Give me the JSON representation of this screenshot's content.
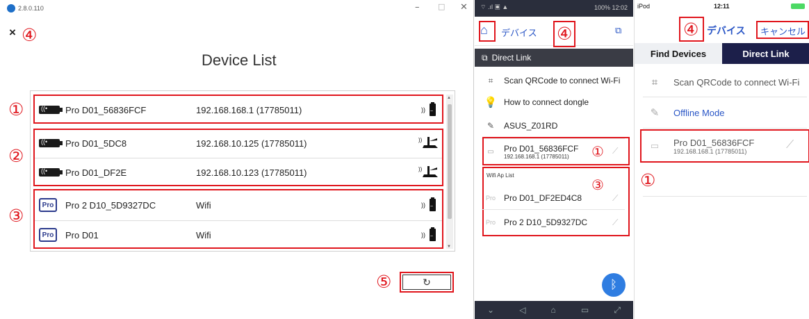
{
  "annotations": {
    "n1": "①",
    "n2": "②",
    "n3": "③",
    "n4": "④",
    "n5": "⑤"
  },
  "desktop": {
    "version": "2.8.0.110",
    "minimize": "–",
    "maximize": "□",
    "close": "✕",
    "close_icon": "×",
    "title": "Device List",
    "devices": [
      {
        "icon": "dongle-icon",
        "name": "Pro D01_56836FCF",
        "ip": "192.168.168.1 (17785011)",
        "signal": "dongle-wifi-icon"
      },
      {
        "icon": "dongle-icon",
        "name": "Pro D01_5DC8",
        "ip": "192.168.10.125 (17785011)",
        "signal": "router-icon"
      },
      {
        "icon": "dongle-icon",
        "name": "Pro D01_DF2E",
        "ip": "192.168.10.123 (17785011)",
        "signal": "router-icon"
      },
      {
        "icon": "pro-icon",
        "name": "Pro 2 D10_5D9327DC",
        "ip": "Wifi",
        "signal": "dongle-wifi-icon"
      },
      {
        "icon": "pro-icon",
        "name": "Pro D01",
        "ip": "Wifi",
        "signal": "dongle-wifi-icon"
      }
    ],
    "pro_label": "Pro",
    "refresh_icon": "↻"
  },
  "android": {
    "status_right": "100% 12:02",
    "header_title": "デバイス",
    "direct_link": "Direct Link",
    "items": [
      {
        "icon": "qr-icon",
        "label": "Scan QRCode to connect Wi-Fi"
      },
      {
        "icon": "bulb-icon",
        "label": "How to connect dongle"
      },
      {
        "icon": "wifi-logo-icon",
        "label": "ASUS_Z01RD"
      }
    ],
    "device": {
      "name": "Pro D01_56836FCF",
      "ip": "192.168.168.1 (17785011)"
    },
    "wifi_ap_title": "Wifi Ap List",
    "wifi_ap": [
      {
        "name": "Pro D01_DF2ED4C8"
      },
      {
        "name": "Pro 2 D10_5D9327DC"
      }
    ],
    "nav": [
      "⌄",
      "◁",
      "⌂",
      "▭",
      "⤢"
    ],
    "bt_icon": "ᛒ"
  },
  "ios": {
    "carrier": "iPod",
    "time": "12:11",
    "header_title": "デバイス",
    "cancel": "キャンセル",
    "tab_find": "Find Devices",
    "tab_direct": "Direct Link",
    "scan": "Scan QRCode to connect Wi-Fi",
    "offline": "Offline Mode",
    "device": {
      "name": "Pro D01_56836FCF",
      "ip": "192.168.168.1 (17785011)"
    }
  },
  "colors": {
    "annotation_red": "#e0151c",
    "ios_tab_dark": "#1c1f4a",
    "link_blue": "#2a56c6",
    "android_dark": "#3a3c45"
  }
}
